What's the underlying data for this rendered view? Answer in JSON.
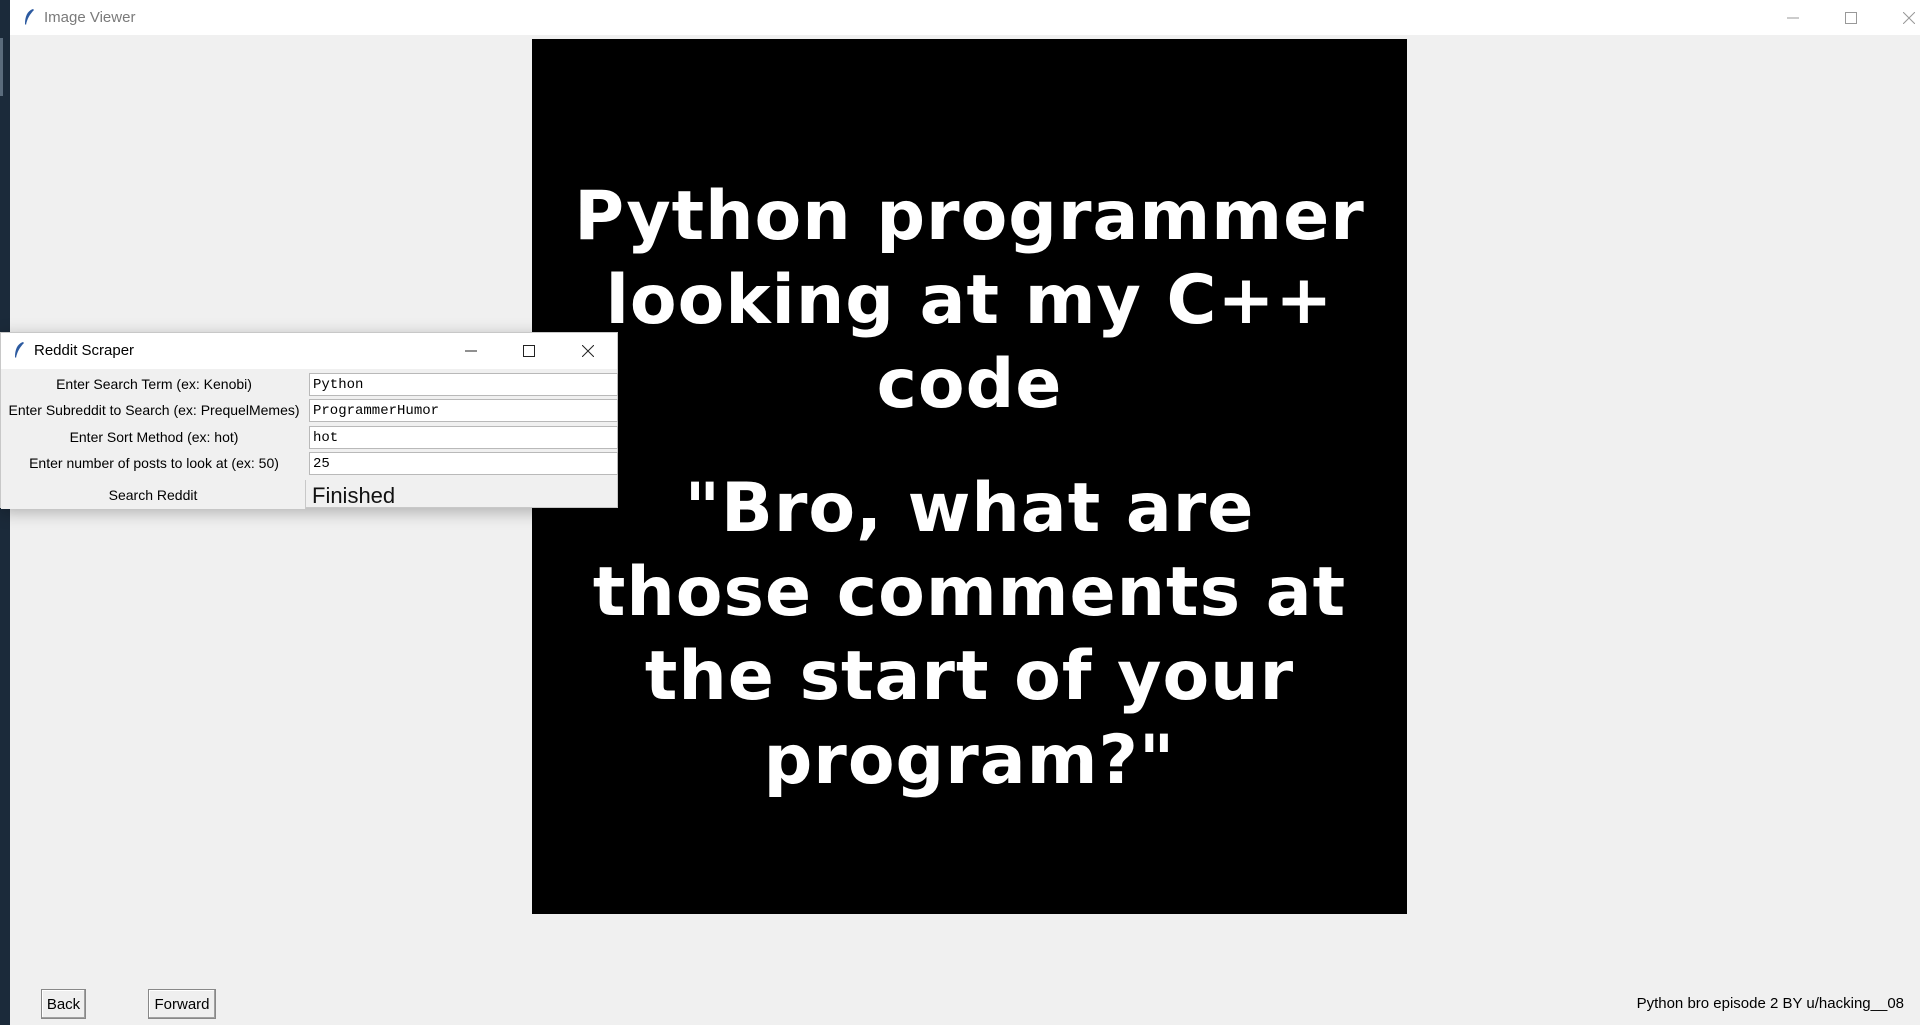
{
  "viewer": {
    "title": "Image Viewer",
    "meme": {
      "lines_top": [
        "Python programmer",
        "looking at my C++",
        "code"
      ],
      "lines_bottom": [
        "\"Bro, what are",
        "those comments at",
        "the start of your",
        "program?\""
      ]
    },
    "back_label": "Back",
    "forward_label": "Forward",
    "caption": "Python bro episode 2 BY u/hacking__08"
  },
  "scraper": {
    "title": "Reddit Scraper",
    "fields": [
      {
        "label": "Enter Search Term (ex: Kenobi)",
        "value": "Python"
      },
      {
        "label": "Enter Subreddit to Search (ex: PrequelMemes)",
        "value": "ProgrammerHumor"
      },
      {
        "label": "Enter Sort Method (ex: hot)",
        "value": "hot"
      },
      {
        "label": "Enter number of posts to look at (ex: 50)",
        "value": "25"
      }
    ],
    "search_label": "Search Reddit",
    "status": "Finished"
  },
  "icons": {
    "app": "tk-feather-icon",
    "minimize": "minimize-icon",
    "maximize": "maximize-icon",
    "close": "close-icon"
  }
}
